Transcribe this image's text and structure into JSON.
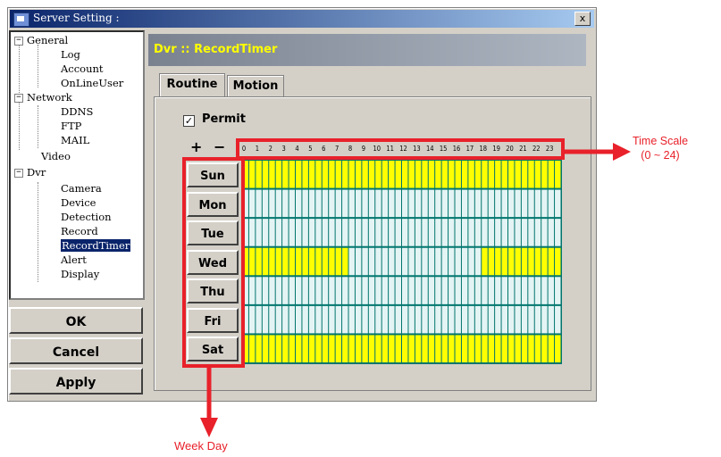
{
  "window": {
    "title": "Server Setting :",
    "close_label": "x"
  },
  "tree": {
    "items": [
      {
        "label": "General",
        "toggle": "−"
      },
      {
        "label": "Log"
      },
      {
        "label": "Account"
      },
      {
        "label": "OnLineUser"
      },
      {
        "label": "Network",
        "toggle": "−"
      },
      {
        "label": "DDNS"
      },
      {
        "label": "FTP"
      },
      {
        "label": "MAIL"
      },
      {
        "label": "Video"
      },
      {
        "label": "Dvr",
        "toggle": "−"
      },
      {
        "label": "Camera"
      },
      {
        "label": "Device"
      },
      {
        "label": "Detection"
      },
      {
        "label": "Record"
      },
      {
        "label": "RecordTimer",
        "selected": true
      },
      {
        "label": "Alert"
      },
      {
        "label": "Display"
      }
    ]
  },
  "buttons": {
    "ok": "OK",
    "cancel": "Cancel",
    "apply": "Apply"
  },
  "header": {
    "title": "Dvr :: RecordTimer"
  },
  "tabs": [
    {
      "label": "Routine",
      "active": true
    },
    {
      "label": "Motion",
      "active": false
    }
  ],
  "permit": {
    "label": "Permit",
    "checked": true,
    "mark": "✓"
  },
  "zoom": {
    "plus": "+",
    "minus": "−"
  },
  "time_scale": {
    "ticks": [
      "0",
      "1",
      "2",
      "3",
      "4",
      "5",
      "6",
      "7",
      "8",
      "9",
      "10",
      "11",
      "12",
      "13",
      "14",
      "15",
      "16",
      "17",
      "18",
      "19",
      "20",
      "21",
      "22",
      "23"
    ]
  },
  "schedule": {
    "slots_per_day": 48,
    "days": [
      {
        "label": "Sun",
        "active_ranges": [
          [
            0,
            24
          ]
        ]
      },
      {
        "label": "Mon",
        "active_ranges": []
      },
      {
        "label": "Tue",
        "active_ranges": []
      },
      {
        "label": "Wed",
        "active_ranges": [
          [
            0,
            8
          ],
          [
            18,
            24
          ]
        ]
      },
      {
        "label": "Thu",
        "active_ranges": []
      },
      {
        "label": "Fri",
        "active_ranges": []
      },
      {
        "label": "Sat",
        "active_ranges": [
          [
            0,
            24
          ]
        ]
      }
    ],
    "active_color": "#ffff00",
    "inactive_color": "#e4f4f4",
    "line_color": "#00756d"
  },
  "annotations": {
    "time_scale_label": "Time Scale",
    "time_scale_range": "(0 ~ 24)",
    "week_day_label": "Week Day",
    "color": "#e8212a"
  }
}
